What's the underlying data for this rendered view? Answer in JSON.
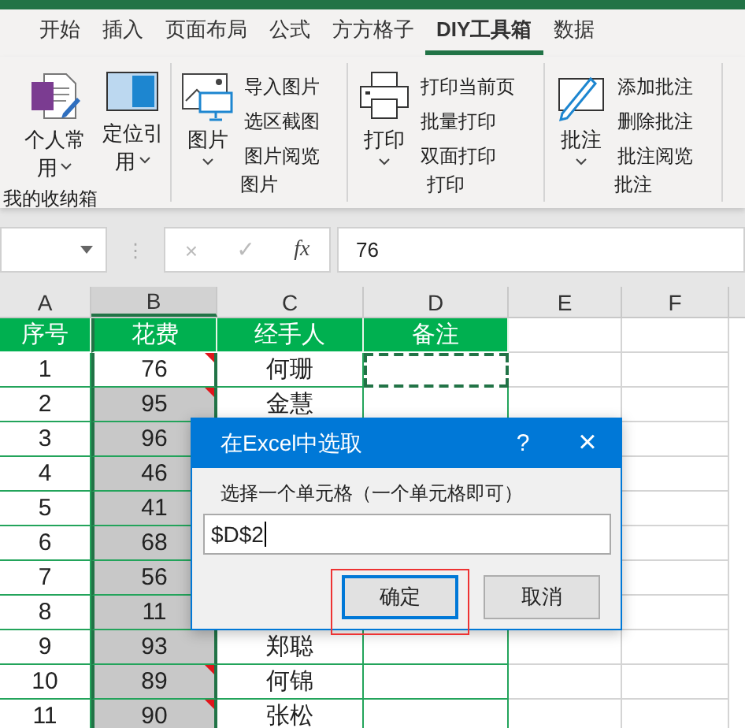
{
  "tabs": [
    {
      "label": "开始",
      "selected": false
    },
    {
      "label": "插入",
      "selected": false
    },
    {
      "label": "页面布局",
      "selected": false
    },
    {
      "label": "公式",
      "selected": false
    },
    {
      "label": "方方格子",
      "selected": false
    },
    {
      "label": "DIY工具箱",
      "selected": true
    },
    {
      "label": "数据",
      "selected": false
    }
  ],
  "ribbon": {
    "groups": [
      {
        "label": "我的收纳箱",
        "kind": "favorites",
        "big": [
          {
            "label": "个人常用"
          },
          {
            "label": "定位引用"
          }
        ]
      },
      {
        "label": "图片",
        "kind": "standard",
        "big": [
          {
            "label": "图片"
          }
        ],
        "small": [
          "导入图片",
          "选区截图",
          "图片阅览"
        ]
      },
      {
        "label": "打印",
        "kind": "standard",
        "big": [
          {
            "label": "打印"
          }
        ],
        "small": [
          "打印当前页",
          "批量打印",
          "双面打印"
        ]
      },
      {
        "label": "批注",
        "kind": "standard",
        "big": [
          {
            "label": "批注"
          }
        ],
        "small": [
          "添加批注",
          "删除批注",
          "批注阅览"
        ]
      }
    ]
  },
  "formula_bar": {
    "handle": "⋮",
    "cancel": "×",
    "enter": "✓",
    "function": "fx",
    "value": "76"
  },
  "sheet": {
    "columns": [
      {
        "label": "A",
        "selected": false
      },
      {
        "label": "B",
        "selected": true
      },
      {
        "label": "C",
        "selected": false
      },
      {
        "label": "D",
        "selected": false
      },
      {
        "label": "E",
        "selected": false
      },
      {
        "label": "F",
        "selected": false
      }
    ],
    "header": [
      "序号",
      "花费",
      "经手人",
      "备注"
    ],
    "rows": [
      {
        "no": "1",
        "cost": "76",
        "person": "何珊",
        "comment": true
      },
      {
        "no": "2",
        "cost": "95",
        "person": "金慧",
        "comment": true
      },
      {
        "no": "3",
        "cost": "96",
        "comment": false
      },
      {
        "no": "4",
        "cost": "46",
        "comment": false
      },
      {
        "no": "5",
        "cost": "41",
        "comment": false
      },
      {
        "no": "6",
        "cost": "68",
        "comment": false
      },
      {
        "no": "7",
        "cost": "56",
        "comment": false
      },
      {
        "no": "8",
        "cost": "11",
        "comment": false
      },
      {
        "no": "9",
        "cost": "93",
        "person": "郑聪",
        "comment": false
      },
      {
        "no": "10",
        "cost": "89",
        "person": "何锦",
        "comment": true
      },
      {
        "no": "11",
        "cost": "90",
        "person": "张松",
        "comment": true
      }
    ]
  },
  "dialog": {
    "title": "在Excel中选取",
    "help": "?",
    "close": "×",
    "prompt": "选择一个单元格（一个单元格即可）",
    "value": "$D$2",
    "buttons": [
      {
        "label": "确定",
        "default": true,
        "highlighted": true
      },
      {
        "label": "取消",
        "default": false,
        "highlighted": false
      }
    ]
  }
}
